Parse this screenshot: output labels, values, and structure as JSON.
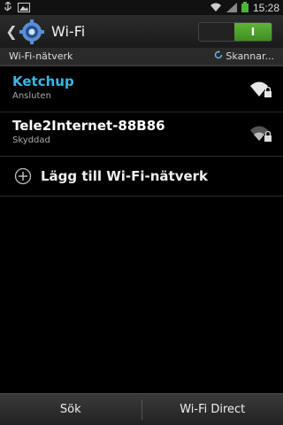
{
  "statusbar": {
    "time": "15:28"
  },
  "actionbar": {
    "title": "Wi-Fi",
    "toggle_label": "I"
  },
  "section": {
    "title": "Wi-Fi-nätverk",
    "scan_label": "Skannar..."
  },
  "networks": [
    {
      "name": "Ketchup",
      "status": "Ansluten",
      "name_color": "#39b6e8"
    },
    {
      "name": "Tele2Internet-88B86",
      "status": "Skyddad",
      "name_color": "#ffffff"
    }
  ],
  "add_network": {
    "label": "Lägg till Wi-Fi-nätverk"
  },
  "bottombar": {
    "search_label": "Sök",
    "direct_label": "Wi-Fi Direct"
  },
  "colors": {
    "accent": "#39b6e8",
    "toggle_on": "#4aa52c"
  }
}
